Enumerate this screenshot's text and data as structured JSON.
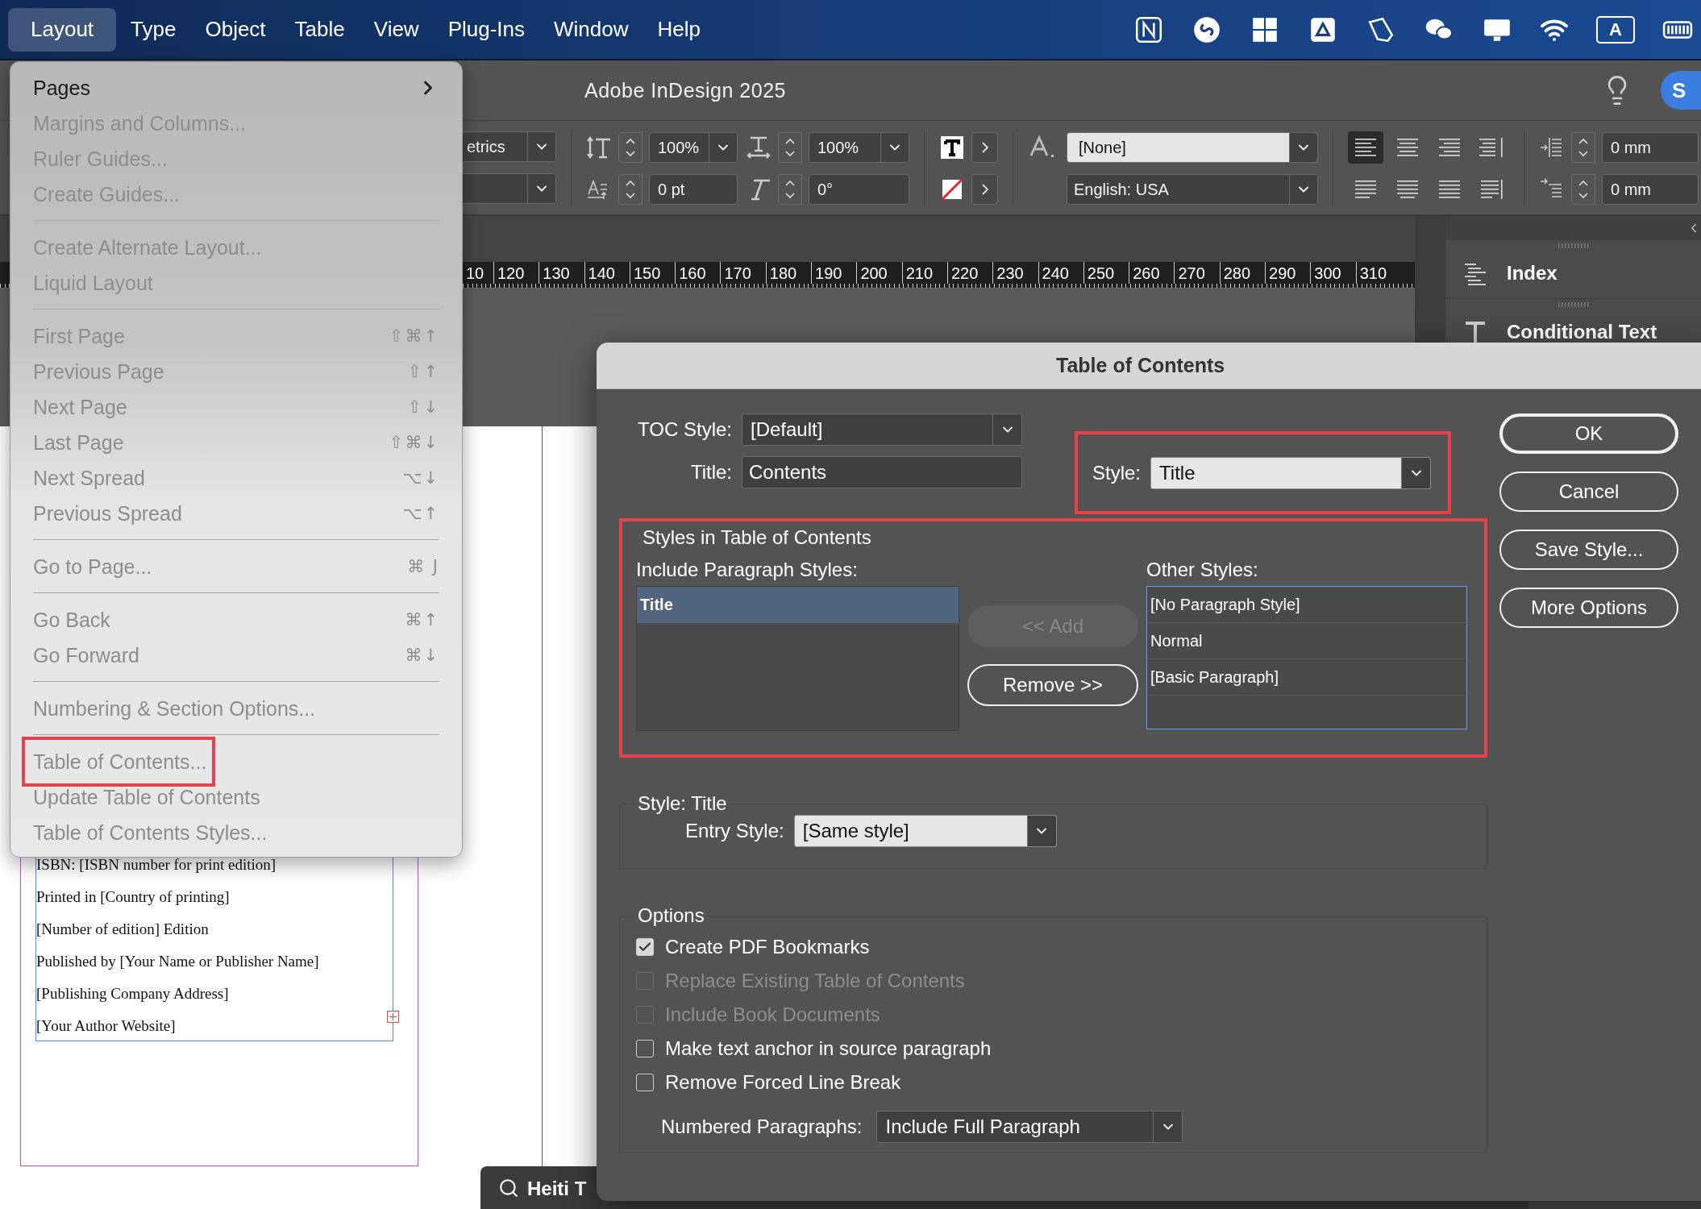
{
  "menu_bar": {
    "items": [
      {
        "label": "Layout",
        "selected": true
      },
      {
        "label": "Type",
        "selected": false
      },
      {
        "label": "Object",
        "selected": false
      },
      {
        "label": "Table",
        "selected": false
      },
      {
        "label": "View",
        "selected": false
      },
      {
        "label": "Plug-Ins",
        "selected": false
      },
      {
        "label": "Window",
        "selected": false
      },
      {
        "label": "Help",
        "selected": false
      }
    ],
    "input_source": "A"
  },
  "app_title": "Adobe InDesign 2025",
  "account_initial": "S",
  "control_panel": {
    "kerning": "etrics",
    "vertical_scale": "100%",
    "baseline_shift": "0 pt",
    "horizontal_scale": "100%",
    "skew": "0°",
    "character_style": "[None]",
    "language": "English: USA",
    "alignment": [
      {
        "selected": true
      },
      {
        "selected": false
      },
      {
        "selected": false
      },
      {
        "selected": false
      },
      {
        "selected": false
      },
      {
        "selected": false
      },
      {
        "selected": false
      },
      {
        "selected": false
      }
    ],
    "left_indent": "0 mm",
    "first_line_indent": "0 mm"
  },
  "ruler": {
    "labels": [
      "10",
      "120",
      "130",
      "140",
      "150",
      "160",
      "170",
      "180",
      "190",
      "200",
      "210",
      "220",
      "230",
      "240",
      "250",
      "260",
      "270",
      "280",
      "290",
      "300",
      "310"
    ]
  },
  "panels": [
    {
      "label": "Index"
    },
    {
      "label": "Conditional Text"
    }
  ],
  "document": {
    "lines": [
      "ISBN: [ISBN number for print edition]",
      "Printed in [Country of printing]",
      "[Number of edition] Edition",
      "Published by [Your Name or Publisher Name]",
      "[Publishing Company Address]",
      "[Your Author Website]"
    ]
  },
  "bottom_bar": {
    "font": "Heiti T"
  },
  "layout_menu": {
    "items": [
      {
        "kind": "item",
        "label": "Pages",
        "disabled": false,
        "submenu": true
      },
      {
        "kind": "item",
        "label": "Margins and Columns...",
        "disabled": true
      },
      {
        "kind": "item",
        "label": "Ruler Guides...",
        "disabled": true
      },
      {
        "kind": "item",
        "label": "Create Guides...",
        "disabled": true
      },
      {
        "kind": "separator"
      },
      {
        "kind": "item",
        "label": "Create Alternate Layout...",
        "disabled": true
      },
      {
        "kind": "item",
        "label": "Liquid Layout",
        "disabled": true
      },
      {
        "kind": "separator"
      },
      {
        "kind": "item",
        "label": "First Page",
        "disabled": true,
        "shortcut": "⇧⌘↑"
      },
      {
        "kind": "item",
        "label": "Previous Page",
        "disabled": true,
        "shortcut": "⇧↑"
      },
      {
        "kind": "item",
        "label": "Next Page",
        "disabled": true,
        "shortcut": "⇧↓"
      },
      {
        "kind": "item",
        "label": "Last Page",
        "disabled": true,
        "shortcut": "⇧⌘↓"
      },
      {
        "kind": "item",
        "label": "Next Spread",
        "disabled": true,
        "shortcut": "⌥↓"
      },
      {
        "kind": "item",
        "label": "Previous Spread",
        "disabled": true,
        "shortcut": "⌥↑"
      },
      {
        "kind": "separator"
      },
      {
        "kind": "item",
        "label": "Go to Page...",
        "disabled": true,
        "shortcut": "⌘ J"
      },
      {
        "kind": "separator"
      },
      {
        "kind": "item",
        "label": "Go Back",
        "disabled": true,
        "shortcut": "⌘↑"
      },
      {
        "kind": "item",
        "label": "Go Forward",
        "disabled": true,
        "shortcut": "⌘↓"
      },
      {
        "kind": "separator"
      },
      {
        "kind": "item",
        "label": "Numbering & Section Options...",
        "disabled": true
      },
      {
        "kind": "separator"
      },
      {
        "kind": "item",
        "label": "Table of Contents...",
        "disabled": true,
        "annotated": true
      },
      {
        "kind": "item",
        "label": "Update Table of Contents",
        "disabled": true
      },
      {
        "kind": "item",
        "label": "Table of Contents Styles...",
        "disabled": true
      }
    ]
  },
  "dialog": {
    "title": "Table of Contents",
    "toc_style": {
      "label": "TOC Style:",
      "value": "[Default]"
    },
    "title_field": {
      "label": "Title:",
      "value": "Contents"
    },
    "style_picker": {
      "label": "Style:",
      "value": "Title",
      "annotated": true
    },
    "styles_group": {
      "legend": "Styles in Table of Contents",
      "annotated": true,
      "include_label": "Include Paragraph Styles:",
      "include_styles": [
        {
          "label": "Title",
          "selected": true
        }
      ],
      "other_label": "Other Styles:",
      "other_styles": [
        {
          "label": "[No Paragraph Style]",
          "selected": false
        },
        {
          "label": "Normal",
          "selected": false
        },
        {
          "label": "[Basic Paragraph]",
          "selected": false
        }
      ],
      "add_button": {
        "label": "<< Add",
        "disabled": true
      },
      "remove_button": {
        "label": "Remove >>",
        "disabled": false
      }
    },
    "entry_group": {
      "legend": "Style: Title",
      "entry_label": "Entry Style:",
      "entry_value": "[Same style]"
    },
    "options_group": {
      "legend": "Options",
      "checkboxes": [
        {
          "label": "Create PDF Bookmarks",
          "checked": true,
          "disabled": false
        },
        {
          "label": "Replace Existing Table of Contents",
          "checked": false,
          "disabled": true
        },
        {
          "label": "Include Book Documents",
          "checked": false,
          "disabled": true
        },
        {
          "label": "Make text anchor in source paragraph",
          "checked": false,
          "disabled": false
        },
        {
          "label": "Remove Forced Line Break",
          "checked": false,
          "disabled": false
        }
      ],
      "numbered_label": "Numbered Paragraphs:",
      "numbered_value": "Include Full Paragraph"
    },
    "buttons": [
      {
        "label": "OK",
        "default": true
      },
      {
        "label": "Cancel",
        "default": false
      },
      {
        "label": "Save Style...",
        "default": false
      },
      {
        "label": "More Options",
        "default": false
      }
    ]
  }
}
